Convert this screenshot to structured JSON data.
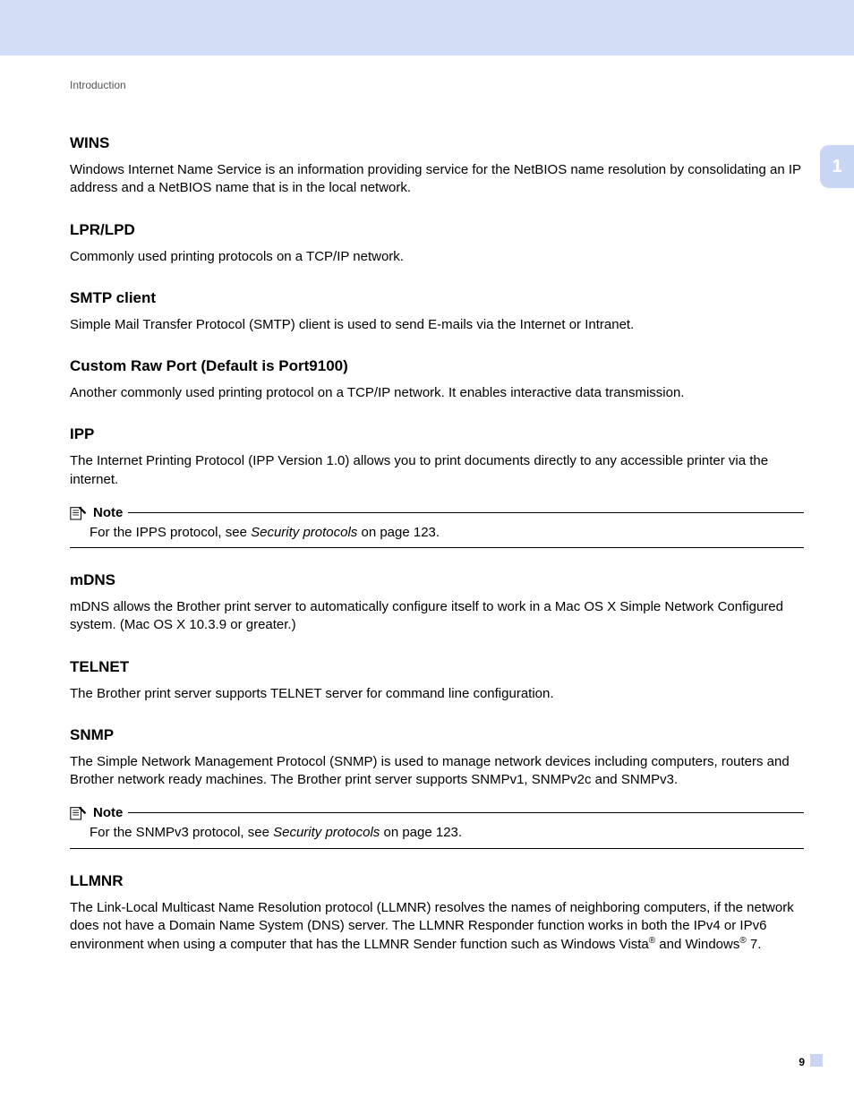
{
  "breadcrumb": "Introduction",
  "chapter_tab": "1",
  "page_number": "9",
  "sections": {
    "wins": {
      "heading": "WINS",
      "body": "Windows Internet Name Service is an information providing service for the NetBIOS name resolution by consolidating an IP address and a NetBIOS name that is in the local network."
    },
    "lprlpd": {
      "heading": "LPR/LPD",
      "body": "Commonly used printing protocols on a TCP/IP network."
    },
    "smtp": {
      "heading": "SMTP client",
      "body": "Simple Mail Transfer Protocol (SMTP) client is used to send E-mails via the Internet or Intranet."
    },
    "rawport": {
      "heading": "Custom Raw Port (Default is Port9100)",
      "body": "Another commonly used printing protocol on a TCP/IP network. It enables interactive data transmission."
    },
    "ipp": {
      "heading": "IPP",
      "body": "The Internet Printing Protocol (IPP Version 1.0) allows you to print documents directly to any accessible printer via the internet."
    },
    "mdns": {
      "heading": "mDNS",
      "body": "mDNS allows the Brother print server to automatically configure itself to work in a Mac OS X Simple Network Configured system. (Mac OS X 10.3.9 or greater.)"
    },
    "telnet": {
      "heading": "TELNET",
      "body": "The Brother print server supports TELNET server for command line configuration."
    },
    "snmp": {
      "heading": "SNMP",
      "body": "The Simple Network Management Protocol (SNMP) is used to manage network devices including computers, routers and Brother network ready machines. The Brother print server supports SNMPv1, SNMPv2c and SNMPv3."
    },
    "llmnr": {
      "heading": "LLMNR",
      "body_pre": "The Link-Local Multicast Name Resolution protocol (LLMNR) resolves the names of neighboring computers, if the network does not have a Domain Name System (DNS) server. The LLMNR Responder function works in both the IPv4 or IPv6 environment when using a computer that has the LLMNR Sender function such as Windows Vista",
      "reg1": "®",
      "mid": " and Windows",
      "reg2": "®",
      "post": " 7."
    }
  },
  "notes": {
    "label": "Note",
    "ipps": {
      "pre": "For the IPPS protocol, see ",
      "link": "Security protocols",
      "post": " on page 123."
    },
    "snmpv3": {
      "pre": "For the SNMPv3 protocol, see ",
      "link": "Security protocols",
      "post": " on page 123."
    }
  }
}
